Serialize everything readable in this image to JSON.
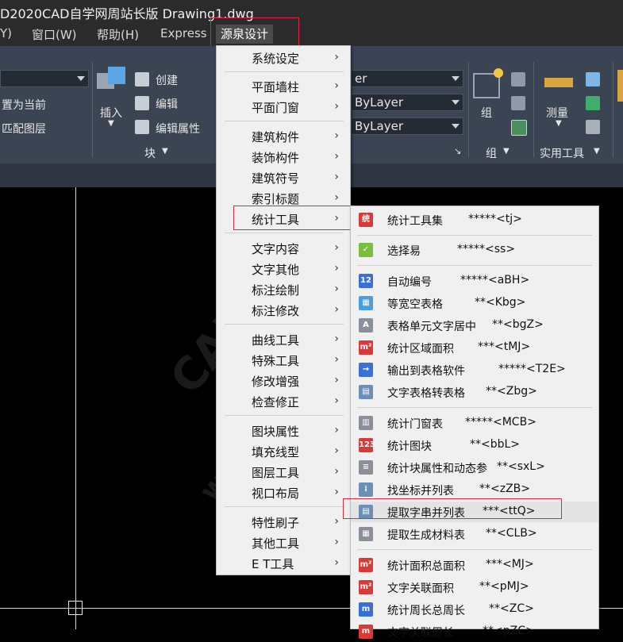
{
  "titlebar": {
    "title": "D2020CAD自学网周站长版    Drawing1.dwg"
  },
  "menubar": {
    "items": [
      {
        "label": "Y)"
      },
      {
        "label": "窗口(W)"
      },
      {
        "label": "帮助(H)"
      },
      {
        "label": "Express"
      },
      {
        "label": "源泉设计"
      }
    ]
  },
  "ribbon": {
    "layer_set_current": "置为当前",
    "match_layer": "匹配图层",
    "insert": "插入",
    "create": "创建",
    "edit": "编辑",
    "edit_attributes": "编辑属性",
    "block_panel": "块",
    "combo_layer": "er",
    "combo_linetype": "ByLayer",
    "combo_lineweight": "ByLayer",
    "group": "组",
    "group_panel": "组",
    "measure": "测量",
    "utilities_panel": "实用工具"
  },
  "menu1": {
    "items": [
      {
        "label": "系统设定"
      },
      {
        "label": "平面墙柱"
      },
      {
        "label": "平面门窗"
      },
      {
        "label": "建筑构件"
      },
      {
        "label": "装饰构件"
      },
      {
        "label": "建筑符号"
      },
      {
        "label": "索引标题"
      },
      {
        "label": "统计工具"
      },
      {
        "label": "文字内容"
      },
      {
        "label": "文字其他"
      },
      {
        "label": "标注绘制"
      },
      {
        "label": "标注修改"
      },
      {
        "label": "曲线工具"
      },
      {
        "label": "特殊工具"
      },
      {
        "label": "修改增强"
      },
      {
        "label": "检查修正"
      },
      {
        "label": "图块属性"
      },
      {
        "label": "填充线型"
      },
      {
        "label": "图层工具"
      },
      {
        "label": "视口布局"
      },
      {
        "label": "特性刷子"
      },
      {
        "label": "其他工具"
      },
      {
        "label": "E T工具"
      }
    ]
  },
  "menu2": {
    "items": [
      {
        "label": "统计工具集",
        "cmd": "*****<tj>"
      },
      {
        "label": "选择易",
        "cmd": "*****<ss>"
      },
      {
        "label": "自动编号",
        "cmd": "*****<aBH>"
      },
      {
        "label": "等宽空表格",
        "cmd": "**<Kbg>"
      },
      {
        "label": "表格单元文字居中",
        "cmd": "**<bgZ>"
      },
      {
        "label": "统计区域面积",
        "cmd": "***<tMJ>"
      },
      {
        "label": "输出到表格软件",
        "cmd": "*****<T2E>"
      },
      {
        "label": "文字表格转表格",
        "cmd": "**<Zbg>"
      },
      {
        "label": "统计门窗表",
        "cmd": "*****<MCB>"
      },
      {
        "label": "统计图块",
        "cmd": "**<bbL>"
      },
      {
        "label": "统计块属性和动态参",
        "cmd": "**<sxL>"
      },
      {
        "label": "找坐标并列表",
        "cmd": "**<zZB>"
      },
      {
        "label": "提取字串并列表",
        "cmd": "***<ttQ>"
      },
      {
        "label": "提取生成材料表",
        "cmd": "**<CLB>"
      },
      {
        "label": "统计面积总面积",
        "cmd": "***<MJ>"
      },
      {
        "label": "文字关联面积",
        "cmd": "**<pMJ>"
      },
      {
        "label": "统计周长总周长",
        "cmd": "**<ZC>"
      },
      {
        "label": "文字关联周长",
        "cmd": "**<pZC>"
      }
    ]
  },
  "watermark": {
    "line1": "CAD自学网",
    "line2": "www.cadzxw.com"
  }
}
